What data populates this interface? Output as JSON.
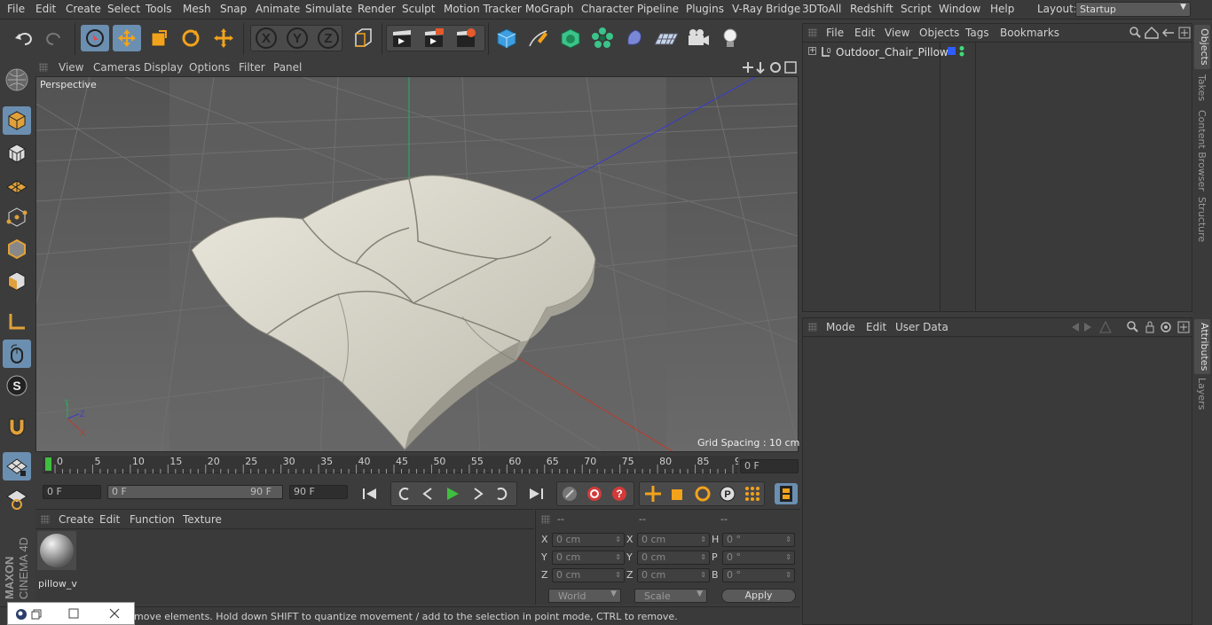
{
  "menubar": {
    "items": [
      "File",
      "Edit",
      "Create",
      "Select",
      "Tools",
      "Mesh",
      "Snap",
      "Animate",
      "Simulate",
      "Render",
      "Sculpt",
      "Motion Tracker",
      "MoGraph",
      "Character",
      "Pipeline",
      "Plugins",
      "V-Ray Bridge",
      "3DToAll",
      "Redshift",
      "Script",
      "Window",
      "Help"
    ],
    "layout_label": "Layout:",
    "layout_value": "Startup"
  },
  "viewport": {
    "menu": [
      "View",
      "Cameras",
      "Display",
      "Options",
      "Filter",
      "Panel"
    ],
    "camera_label": "Perspective",
    "grid_spacing": "Grid Spacing : 10 cm"
  },
  "timeline": {
    "ticks": [
      "0",
      "5",
      "10",
      "15",
      "20",
      "25",
      "30",
      "35",
      "40",
      "45",
      "50",
      "55",
      "60",
      "65",
      "70",
      "75",
      "80",
      "85",
      "90"
    ],
    "current_frame": "0 F",
    "start_field": "0 F",
    "range_start": "0 F",
    "range_end": "90 F",
    "end_field": "90 F"
  },
  "material_manager": {
    "menu": [
      "Create",
      "Edit",
      "Function",
      "Texture"
    ],
    "material_name": "pillow_v"
  },
  "coordinates": {
    "headers": [
      "--",
      "--",
      "--"
    ],
    "rows": [
      {
        "l1": "X",
        "v1": "0 cm",
        "l2": "X",
        "v2": "0 cm",
        "l3": "H",
        "v3": "0 °"
      },
      {
        "l1": "Y",
        "v1": "0 cm",
        "l2": "Y",
        "v2": "0 cm",
        "l3": "P",
        "v3": "0 °"
      },
      {
        "l1": "Z",
        "v1": "0 cm",
        "l2": "Z",
        "v2": "0 cm",
        "l3": "B",
        "v3": "0 °"
      }
    ],
    "space_dropdown": "World",
    "mode_dropdown": "Scale",
    "apply_label": "Apply"
  },
  "status_text": "move elements. Hold down SHIFT to quantize movement / add to the selection in point mode, CTRL to remove.",
  "object_manager": {
    "menu": [
      "File",
      "Edit",
      "View",
      "Objects",
      "Tags",
      "Bookmarks"
    ],
    "objects": [
      {
        "name": "Outdoor_Chair_Pillow",
        "layer_color": "#2f5cff"
      }
    ]
  },
  "attribute_manager": {
    "menu": [
      "Mode",
      "Edit",
      "User Data"
    ]
  },
  "right_tabs": {
    "top": [
      "Objects",
      "Takes",
      "Content Browser",
      "Structure"
    ],
    "bottom": [
      "Attributes",
      "Layers"
    ]
  },
  "branding": {
    "maxon": "MAXON",
    "product": "CINEMA 4D"
  },
  "colors": {
    "accent": "#6b8fb0",
    "play": "#3fbf3f",
    "record": "#d33a3a",
    "axis_x": "#c0392b",
    "axis_y": "#27ae60",
    "axis_z": "#3a3ad0"
  }
}
